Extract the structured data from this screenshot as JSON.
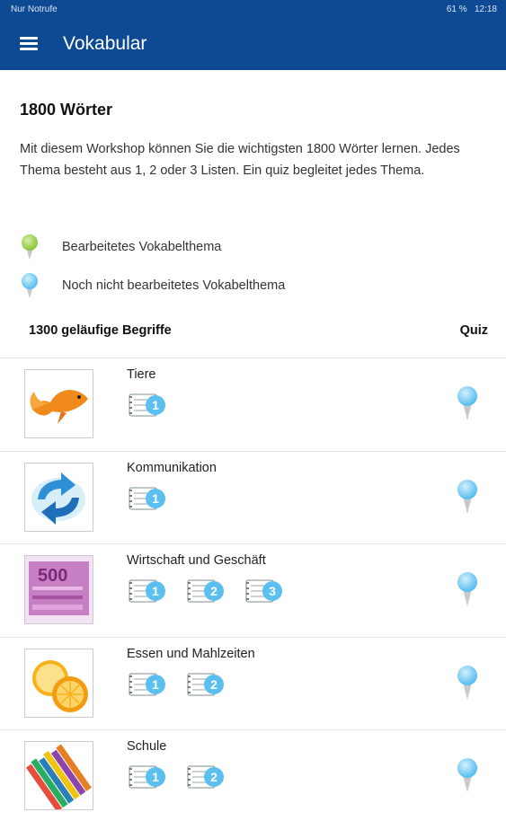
{
  "status": {
    "left": "Nur Notrufe",
    "battery": "61 %",
    "time": "12:18"
  },
  "appbar": {
    "title": "Vokabular",
    "menu_icon": "hamburger-icon"
  },
  "intro": {
    "heading": "1800 Wörter",
    "description": "Mit diesem Workshop können Sie die wichtigsten 1800 Wörter lernen. Jedes Thema besteht aus 1, 2 oder 3 Listen. Ein quiz begleitet jedes Thema."
  },
  "legend": [
    {
      "label": "Bearbeitetes Vokabelthema",
      "color": "#8cc63f"
    },
    {
      "label": "Noch nicht bearbeitetes Vokabelthema",
      "color": "#5bc0f0"
    }
  ],
  "section": {
    "title": "1300 geläufige Begriffe",
    "quiz_label": "Quiz"
  },
  "topics": [
    {
      "name": "Tiere",
      "image": "goldfish-image",
      "lists": [
        "1"
      ]
    },
    {
      "name": "Kommunikation",
      "image": "refresh-arrows-image",
      "lists": [
        "1"
      ]
    },
    {
      "name": "Wirtschaft und Geschäft",
      "image": "euro-banknote-image",
      "lists": [
        "1",
        "2",
        "3"
      ]
    },
    {
      "name": "Essen und Mahlzeiten",
      "image": "orange-slices-image",
      "lists": [
        "1",
        "2"
      ]
    },
    {
      "name": "Schule",
      "image": "colored-pencils-image",
      "lists": [
        "1",
        "2"
      ]
    }
  ]
}
